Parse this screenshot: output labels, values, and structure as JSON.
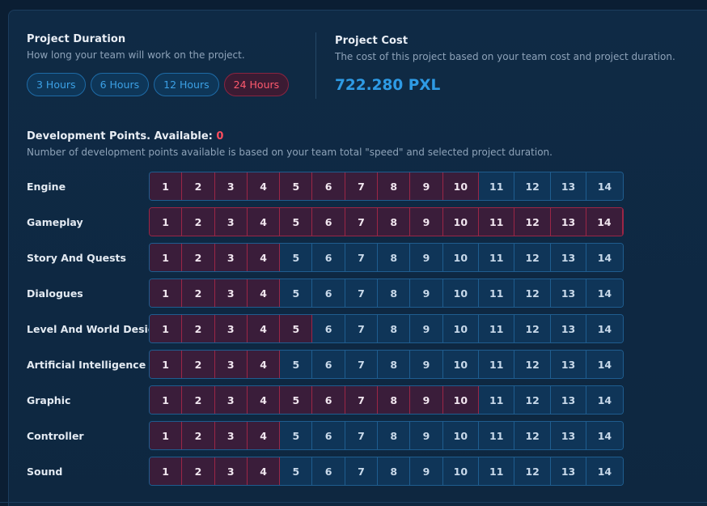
{
  "duration": {
    "title": "Project Duration",
    "subtitle": "How long your team will work on the project.",
    "options": [
      {
        "label": "3 Hours",
        "selected": false
      },
      {
        "label": "6 Hours",
        "selected": false
      },
      {
        "label": "12 Hours",
        "selected": false
      },
      {
        "label": "24 Hours",
        "selected": true
      }
    ]
  },
  "cost": {
    "title": "Project Cost",
    "subtitle": "The cost of this project based on your team cost and project duration.",
    "value": "722.280 PXL"
  },
  "dev": {
    "title_prefix": "Development Points. Available: ",
    "available": "0",
    "subtitle": "Number of development points available is based on your team total \"speed\" and selected project duration."
  },
  "max_points": 14,
  "categories": [
    {
      "label": "Engine",
      "value": 10
    },
    {
      "label": "Gameplay",
      "value": 14
    },
    {
      "label": "Story And Quests",
      "value": 4
    },
    {
      "label": "Dialogues",
      "value": 4
    },
    {
      "label": "Level And World Design",
      "value": 5
    },
    {
      "label": "Artificial Intelligence",
      "value": 4
    },
    {
      "label": "Graphic",
      "value": 10
    },
    {
      "label": "Controller",
      "value": 4
    },
    {
      "label": "Sound",
      "value": 4
    }
  ],
  "colors": {
    "accent_blue": "#2e9be5",
    "selected_red": "#ff4d5e",
    "cell_on": "#3a1d3a",
    "cell_off": "#0f3558"
  }
}
